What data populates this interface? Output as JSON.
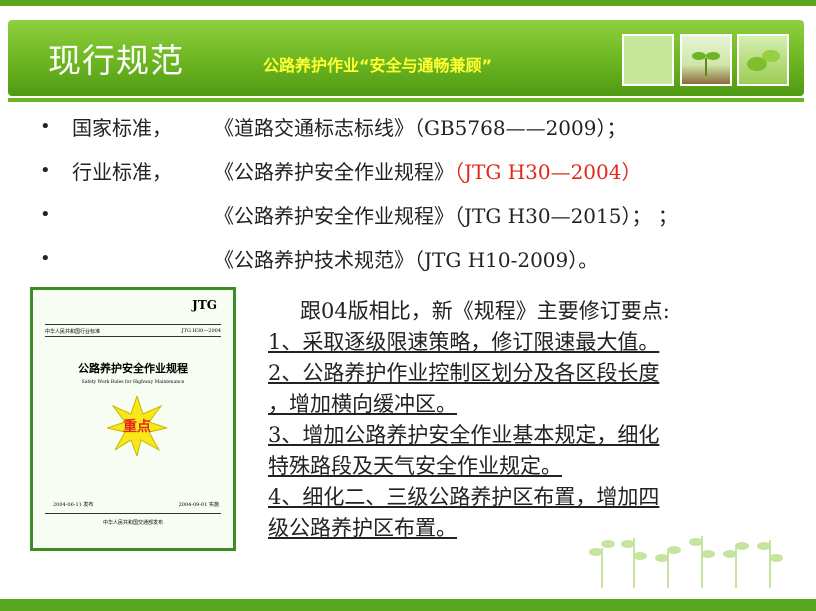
{
  "header": {
    "title": "现行规范",
    "subtitle": "公路养护作业“安全与通畅兼顾”"
  },
  "bullets": [
    {
      "lead": "国家标准，",
      "doc": "《道路交通标志标线》（GB5768——2009）；",
      "code": ""
    },
    {
      "lead": "行业标准，",
      "doc": "《公路养护安全作业规程》",
      "code": "（JTG H30—2004）"
    },
    {
      "lead": "",
      "doc": "《公路养护安全作业规程》（JTG H30—2015）；  ；",
      "code": ""
    },
    {
      "lead": "",
      "doc": "《公路养护技术规范》（JTG H10-2009）。",
      "code": ""
    }
  ],
  "cover": {
    "jtg": "JTG",
    "std_left": "中华人民共和国行业标准",
    "std_right": "JTG H30—2004",
    "title": "公路养护安全作业规程",
    "english": "Safety Work Rules for Highway Maintenance",
    "stamp": "重点",
    "issue_date": "2004-06-11 发布",
    "effective_date": "2004-09-01 实施",
    "publisher": "中华人民共和国交通部发布"
  },
  "changes": {
    "heading": "跟04版相比，新《规程》主要修订要点:",
    "items": [
      "1、采取逐级限速策略，修订限速最大值。",
      "2、公路养护作业控制区划分及各区段长度",
      "，增加横向缓冲区。",
      "3、增加公路养护安全作业基本规定，细化",
      "特殊路段及天气安全作业规定。",
      "4、细化二、三级公路养护区布置，增加四",
      "级公路养护区布置。"
    ]
  },
  "colors": {
    "brand_green": "#6cb521",
    "subtitle_yellow": "#ffff33",
    "highlight_red": "#e3271a"
  }
}
